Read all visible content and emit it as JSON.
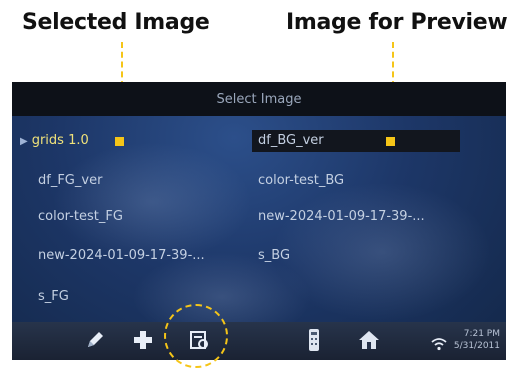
{
  "callouts": {
    "selected": "Selected Image",
    "preview": "Image for Preview"
  },
  "header": {
    "title": "Select Image"
  },
  "files": {
    "left": [
      "grids 1.0",
      "df_FG_ver",
      "color-test_FG",
      "new-2024-01-09-17-39-...",
      "s_FG"
    ],
    "right": [
      "df_BG_ver",
      "color-test_BG",
      "new-2024-01-09-17-39-...",
      "s_BG"
    ]
  },
  "toolbar": {
    "icons": [
      "pencil-icon",
      "plus-icon",
      "image-select-icon",
      "remote-icon",
      "home-icon",
      "wifi-icon"
    ],
    "time": "7:21 PM",
    "date": "5/31/2011"
  },
  "colors": {
    "annotation": "#f5c518",
    "selected_text": "#f0e27a",
    "screen_bg": "#1d3768"
  }
}
